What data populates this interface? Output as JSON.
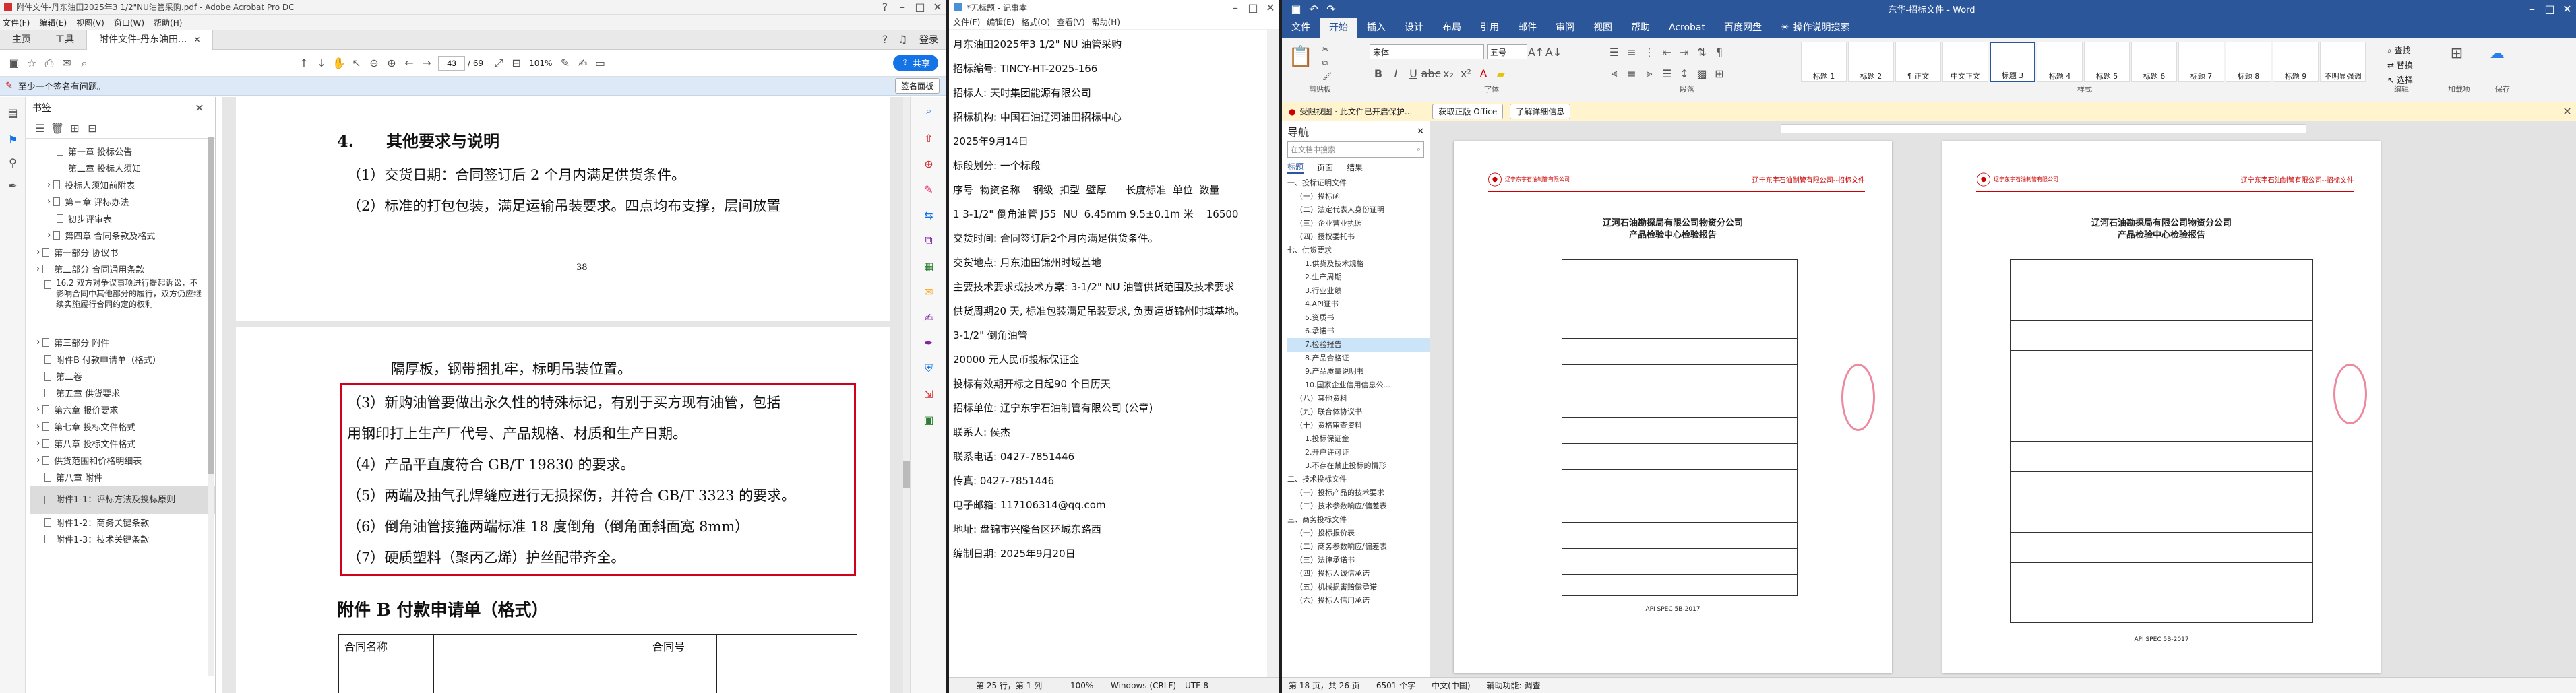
{
  "acrobat": {
    "title": "附件文件-丹东油田2025年3 1/2\"NU油管采购.pdf - Adobe Acrobat Pro DC",
    "menu": [
      "文件(F)",
      "编辑(E)",
      "视图(V)",
      "窗口(W)",
      "帮助(H)"
    ],
    "tabs": [
      "主页",
      "工具",
      "附件文件-丹东油田..."
    ],
    "page_current": "43",
    "page_total": "/ 69",
    "zoom": "101%",
    "share": "共享",
    "banner": "至少一个签名有问题。",
    "banner_btn": "签名面板",
    "bm_title": "书签",
    "bookmarks": [
      "第一章 投标公告",
      "第二章 投标人须知",
      "投标人须知前附表",
      "第三章 评标办法",
      "初步评审表",
      "第四章 合同条款及格式",
      "第一部分 协议书",
      "第二部分 合同通用条款",
      "16.2 双方对争议事项进行提起诉讼，不影响合同中其他部分的履行，双方仍应继续实施履行合同约定的权利",
      "第三部分 附件",
      "附件B 付款申请单（格式）",
      "第二卷",
      "第五章 供货要求",
      "第六章 报价要求",
      "第七章 投标文件格式",
      "第八章 投标文件格式",
      "供货范围和价格明细表",
      "第八章 附件",
      "附件1-1：评标方法及投标原则",
      "附件1-2：商务关键条款",
      "附件1-3：技术关键条款"
    ],
    "page1": {
      "heading": "4.　　其他要求与说明",
      "l1": "（1）交货日期：合同签订后 2 个月内满足供货条件。",
      "l2": "（2）标准的打包包装，满足运输吊装要求。四点均布支撑，层间放置",
      "num": "38"
    },
    "page2": {
      "cont": "隔厚板，钢带捆扎牢，标明吊装位置。",
      "l3": "（3）新购油管要做出永久性的特殊标记，有别于买方现有油管，包括",
      "l3b": "用钢印打上生产厂代号、产品规格、材质和生产日期。",
      "l4": "（4）产品平直度符合 GB/T 19830 的要求。",
      "l5": "（5）两端及抽气孔焊缝应进行无损探伤，并符合 GB/T 3323 的要求。",
      "l6": "（6）倒角油管接箍两端标准 18 度倒角（倒角面斜面宽 8mm）",
      "l7": "（7）硬质塑料（聚丙乙烯）护丝配带齐全。",
      "annexB": "附件 B  付款申请单（格式）",
      "tbl1": "合同名称",
      "tbl2": "合同号"
    }
  },
  "notepad": {
    "title": "*无标题 - 记事本",
    "menu": [
      "文件(F)",
      "编辑(E)",
      "格式(O)",
      "查看(V)",
      "帮助(H)"
    ],
    "lines": [
      "月东油田2025年3 1/2\" NU 油管采购",
      "招标编号: TINCY-HT-2025-166",
      "招标人: 天时集团能源有限公司",
      "招标机构: 中国石油辽河油田招标中心",
      "2025年9月14日",
      "标段划分: 一个标段",
      "序号  物资名称    钢级  扣型  壁厚      长度标准  单位  数量",
      "1 3-1/2\" 倒角油管 J55  NU  6.45mm 9.5±0.1m 米    16500",
      "交货时间: 合同签订后2个月内满足供货条件。",
      "交货地点: 月东油田锦州时域基地",
      "主要技术要求或技术方案: 3-1/2\" NU 油管供货范围及技术要求",
      "供货周期20 天, 标准包装满足吊装要求, 负责运货锦州时域基地。",
      "3-1/2\" 倒角油管",
      "20000 元人民币投标保证金",
      "投标有效期开标之日起90 个日历天",
      "招标单位: 辽宁东宇石油制管有限公司 (公章)",
      "联系人: 侯杰",
      "联系电话: 0427-7851446",
      "传真: 0427-7851446",
      "电子邮箱: 117106314@qq.com",
      "地址: 盘锦市兴隆台区环城东路西",
      "编制日期: 2025年9月20日"
    ],
    "status": [
      "第 25 行，第 1 列",
      "100%",
      "Windows (CRLF)",
      "UTF-8"
    ]
  },
  "word": {
    "title": "东华-招标文件 - Word",
    "tabs": [
      "文件",
      "开始",
      "插入",
      "设计",
      "布局",
      "引用",
      "邮件",
      "审阅",
      "视图",
      "帮助",
      "Acrobat",
      "百度网盘",
      "操作说明搜索"
    ],
    "font_name": "宋体",
    "font_size": "五号",
    "styles": [
      "标题 1",
      "标题 2",
      "¶ 正文",
      "中文正文",
      "标题 3",
      "标题 4",
      "标题 5",
      "标题 6",
      "标题 7",
      "标题 8",
      "标题 9",
      "不明显强调"
    ],
    "groups": [
      "剪贴板",
      "字体",
      "段落",
      "样式",
      "编辑",
      "加载项",
      "保存"
    ],
    "msg": "受限视图 · 此文件已开启保护...",
    "msg_b1": "获取正版 Office",
    "msg_b2": "了解详细信息",
    "nav_title": "导航",
    "nav_search": "在文档中搜索",
    "nav_tabs": [
      "标题",
      "页面",
      "结果"
    ],
    "nav_items": [
      "一、投标证明文件",
      "（一）投标函",
      "（二）法定代表人身份证明",
      "（三）企业营业执照",
      "（四）授权委托书",
      "七、供货要求",
      "1.供货及技术规格",
      "2.生产周期",
      "3.行业业绩",
      "4.API证书",
      "5.资质书",
      "6.承诺书",
      "7.检验报告",
      "8.产品合格证",
      "9.产品质量说明书",
      "10.国家企业信用信息公...",
      "（八）其他资料",
      "（九）联合体协议书",
      "（十）资格审查资料",
      "1.投标保证金",
      "2.开户许可证",
      "3.不存在禁止投标的情形",
      "二、技术投标文件",
      "（一）投标产品的技术要求",
      "（二）技术参数响应/偏差表",
      "三、商务投标文件",
      "（一）投标报价表",
      "（二）商务参数响应/偏差表",
      "（三）法律承诺书",
      "（四）投标人诚信承诺",
      "（五）机械损害赔偿承诺",
      "（六）投标人信用承诺"
    ],
    "report_title": "辽河石油勘探局有限公司物资分公司",
    "report_sub": "产品检验中心检验报告",
    "report_org": "辽宁东宇石油制管有限公司",
    "report_hdr": "辽宁东宇石油制管有限公司--招标文件",
    "std": "API SPEC 5B-2017",
    "status": [
      "第 18 页，共 26 页",
      "6501 个字",
      "中文(中国)",
      "辅助功能: 调查"
    ]
  }
}
